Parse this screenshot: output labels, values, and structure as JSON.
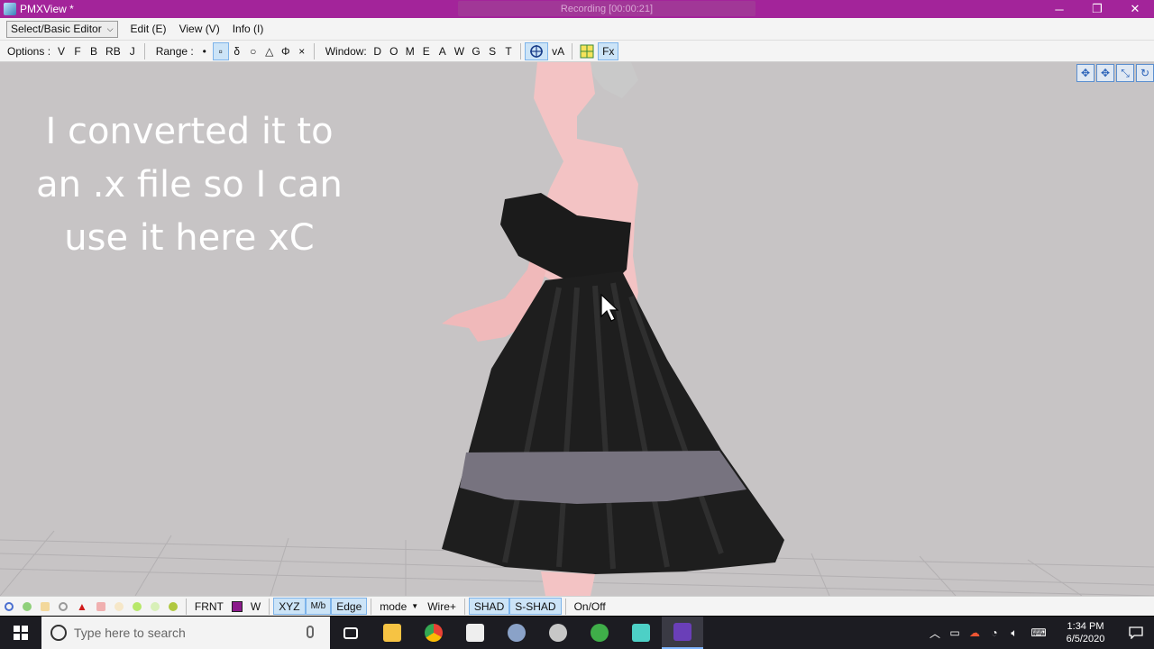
{
  "window": {
    "title": "PMXView *",
    "recording_label": "Recording [00:00:21]"
  },
  "menubar": {
    "editor_select": "Select/Basic Editor",
    "items": [
      "Edit (E)",
      "View (V)",
      "Info (I)"
    ]
  },
  "toolbar": {
    "options_label": "Options :",
    "options": [
      "V",
      "F",
      "B",
      "RB",
      "J"
    ],
    "range_label": "Range :",
    "range": [
      "•",
      "▫",
      "δ",
      "○",
      "△",
      "Φ",
      "×"
    ],
    "window_label": "Window:",
    "window": [
      "D",
      "O",
      "M",
      "E",
      "A",
      "W",
      "G",
      "S",
      "T"
    ],
    "va_label": "vA",
    "fx_label": "Fx"
  },
  "viewport": {
    "overlay_text": "I converted it to an .x file so I can use it here xC"
  },
  "bottombar": {
    "frnt": "FRNT",
    "w": "W",
    "xyz": "XYZ",
    "mb": "M/b",
    "edge": "Edge",
    "mode": "mode",
    "wire": "Wire+",
    "shad": "SHAD",
    "sshad": "S-SHAD",
    "onoff": "On/Off"
  },
  "taskbar": {
    "search_placeholder": "Type here to search",
    "time": "1:34 PM",
    "date": "6/5/2020"
  },
  "colors": {
    "titlebar": "#a3249a",
    "viewport_bg": "#c7c4c5",
    "dress": "#1b1b1b",
    "dress_band": "#77737f",
    "skin": "#f3c3c4"
  }
}
